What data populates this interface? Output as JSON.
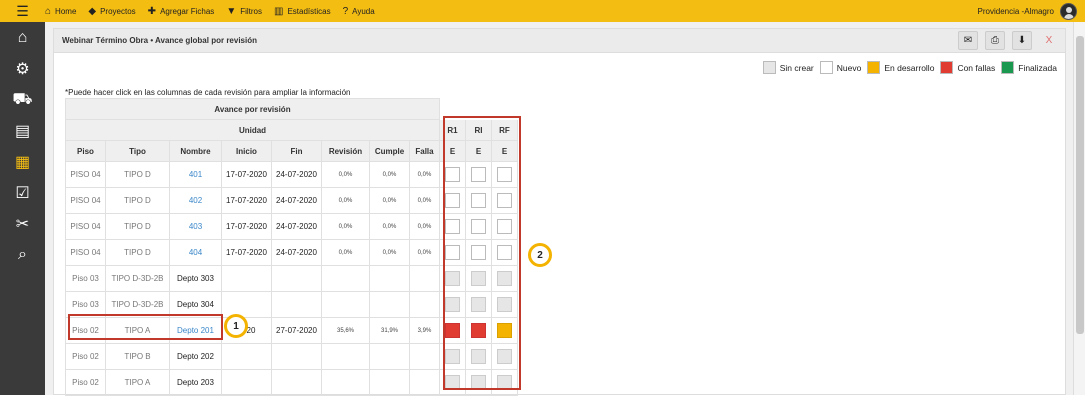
{
  "topbar": {
    "menu_icon": "hamburger-icon",
    "items": [
      {
        "label": "Home",
        "icon": "home-icon"
      },
      {
        "label": "Proyectos",
        "icon": "tag-icon"
      },
      {
        "label": "Agregar Fichas",
        "icon": "plus-icon"
      },
      {
        "label": "Filtros",
        "icon": "filter-icon"
      },
      {
        "label": "Estadísticas",
        "icon": "chart-icon"
      },
      {
        "label": "Ayuda",
        "icon": "question-icon"
      }
    ],
    "user": "Providencia -Almagro"
  },
  "sidebar": {
    "items": [
      "home-icon",
      "gears-icon",
      "truck-icon",
      "document-icon",
      "clipboard-icon",
      "checklist-icon",
      "tools-icon",
      "search-chart-icon"
    ],
    "active_index": 4
  },
  "panel": {
    "title": "Webinar Término Obra • Avance global por revisión",
    "close": "X"
  },
  "legend": [
    {
      "label": "Sin crear",
      "color": "#e6e6e6"
    },
    {
      "label": "Nuevo",
      "color": "#ffffff"
    },
    {
      "label": "En desarrollo",
      "color": "#f3b300"
    },
    {
      "label": "Con fallas",
      "color": "#e03c31"
    },
    {
      "label": "Finalizada",
      "color": "#1a9850"
    }
  ],
  "note": "*Puede hacer click en las columnas de cada revisión para ampliar la información",
  "table": {
    "group_header": "Avance por revisión",
    "unit_header": "Unidad",
    "rev_headers": [
      "R1",
      "RI",
      "RF"
    ],
    "columns": [
      "Piso",
      "Tipo",
      "Nombre",
      "Inicio",
      "Fin",
      "Revisión",
      "Cumple",
      "Falla"
    ],
    "sub_headers": [
      "E",
      "E",
      "E"
    ],
    "rows": [
      {
        "piso": "PISO 04",
        "tipo": "TIPO D",
        "nombre": "401",
        "inicio": "17-07-2020",
        "fin": "24-07-2020",
        "revision": "0,0%",
        "cumple": "0,0%",
        "falla": "0,0%",
        "states": [
          "new",
          "new",
          "new"
        ]
      },
      {
        "piso": "PISO 04",
        "tipo": "TIPO D",
        "nombre": "402",
        "inicio": "17-07-2020",
        "fin": "24-07-2020",
        "revision": "0,0%",
        "cumple": "0,0%",
        "falla": "0,0%",
        "states": [
          "new",
          "new",
          "new"
        ]
      },
      {
        "piso": "PISO 04",
        "tipo": "TIPO D",
        "nombre": "403",
        "inicio": "17-07-2020",
        "fin": "24-07-2020",
        "revision": "0,0%",
        "cumple": "0,0%",
        "falla": "0,0%",
        "states": [
          "new",
          "new",
          "new"
        ]
      },
      {
        "piso": "PISO 04",
        "tipo": "TIPO D",
        "nombre": "404",
        "inicio": "17-07-2020",
        "fin": "24-07-2020",
        "revision": "0,0%",
        "cumple": "0,0%",
        "falla": "0,0%",
        "states": [
          "new",
          "new",
          "new"
        ]
      },
      {
        "piso": "Piso 03",
        "tipo": "TIPO D-3D-2B",
        "nombre": "Depto 303",
        "inicio": "",
        "fin": "",
        "revision": "",
        "cumple": "",
        "falla": "",
        "states": [
          "none",
          "none",
          "none"
        ]
      },
      {
        "piso": "Piso 03",
        "tipo": "TIPO D-3D-2B",
        "nombre": "Depto 304",
        "inicio": "",
        "fin": "",
        "revision": "",
        "cumple": "",
        "falla": "",
        "states": [
          "none",
          "none",
          "none"
        ]
      },
      {
        "piso": "Piso 02",
        "tipo": "TIPO A",
        "nombre": "Depto 201",
        "inicio": "2020",
        "fin": "27-07-2020",
        "revision": "35,6%",
        "cumple": "31,9%",
        "falla": "3,9%",
        "states": [
          "fail",
          "fail",
          "dev"
        ]
      },
      {
        "piso": "Piso 02",
        "tipo": "TIPO B",
        "nombre": "Depto 202",
        "inicio": "",
        "fin": "",
        "revision": "",
        "cumple": "",
        "falla": "",
        "states": [
          "none",
          "none",
          "none"
        ]
      },
      {
        "piso": "Piso 02",
        "tipo": "TIPO A",
        "nombre": "Depto 203",
        "inicio": "",
        "fin": "",
        "revision": "",
        "cumple": "",
        "falla": "",
        "states": [
          "none",
          "none",
          "none"
        ]
      }
    ]
  },
  "callouts": [
    "1",
    "2"
  ]
}
